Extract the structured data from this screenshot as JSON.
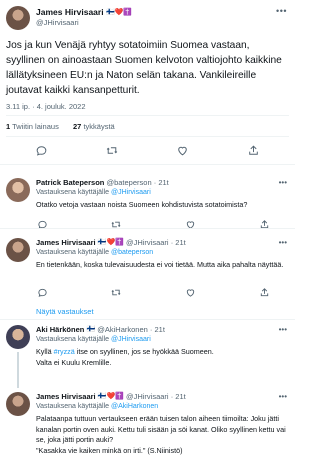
{
  "main_tweet": {
    "name": "James Hirvisaari",
    "name_emoji": "🇫🇮❤️✝️",
    "handle": "@JHirvisaari",
    "text": "Jos ja kun Venäjä ryhtyy sotatoimiin Suomea vastaan, syyllinen on ainoastaan Suomen kelvoton valtiojohto kaikkine lällätyksineen EU:n ja Naton selän takana. Vankileireille joutavat kaikki kansanpetturit.",
    "time": "3.11 ip.",
    "date": "4. jouluk. 2022",
    "retweets_count": "1",
    "retweets_label": "Twiitin lainaus",
    "likes_count": "27",
    "likes_label": "tykkäystä"
  },
  "replies": [
    {
      "name": "Patrick Bateperson",
      "handle": "@bateperson",
      "time": "21t",
      "replying_prefix": "Vastauksena käyttäjälle",
      "replying_to": "@JHirvisaari",
      "text": "Otatko vetoja vastaan noista Suomeen kohdistuvista sotatoimista?"
    },
    {
      "name": "James Hirvisaari",
      "name_emoji": "🇫🇮❤️✝️",
      "handle": "@JHirvisaari",
      "time": "21t",
      "replying_prefix": "Vastauksena käyttäjälle",
      "replying_to": "@bateperson",
      "text": "En tietenkään, koska tulevaisuudesta ei voi tietää. Mutta aika pahalta näyttää.",
      "show_replies": "Näytä vastaukset"
    },
    {
      "name": "Aki Härkönen",
      "name_emoji": "🇫🇮",
      "handle": "@AkiHarkonen",
      "time": "21t",
      "replying_prefix": "Vastauksena käyttäjälle",
      "replying_to": "@JHirvisaari",
      "text_before": "Kyllä ",
      "hashtag": "#ryzzä",
      "text_after": " itse on syyllinen, jos se hyökkää Suomeen.",
      "text_line2": "Valta ei Kuulu Kremlille."
    },
    {
      "name": "James Hirvisaari",
      "name_emoji": "🇫🇮❤️✝️",
      "handle": "@JHirvisaari",
      "time": "21t",
      "replying_prefix": "Vastauksena käyttäjälle",
      "replying_to": "@AkiHarkonen",
      "text": "Palataanpa tuttuun vertaukseen erään tuisen talon aiheen tiimoilta: Joku jätti kanalan portin oven auki. Kettu tuli sisään ja söi kanat. Oliko syyllinen kettu vai se, joka jätti portin auki?",
      "text_line2": "\"Kasakka vie kaiken minkä on irti.\" (S.Niinistö)"
    }
  ],
  "icons": {
    "more": "more-icon",
    "reply": "reply-icon",
    "retweet": "retweet-icon",
    "like": "heart-icon",
    "share": "share-icon"
  },
  "colors": {
    "accent": "#1d9bf0",
    "muted": "#536471",
    "text": "#0f1419",
    "divider": "#eff3f4"
  }
}
